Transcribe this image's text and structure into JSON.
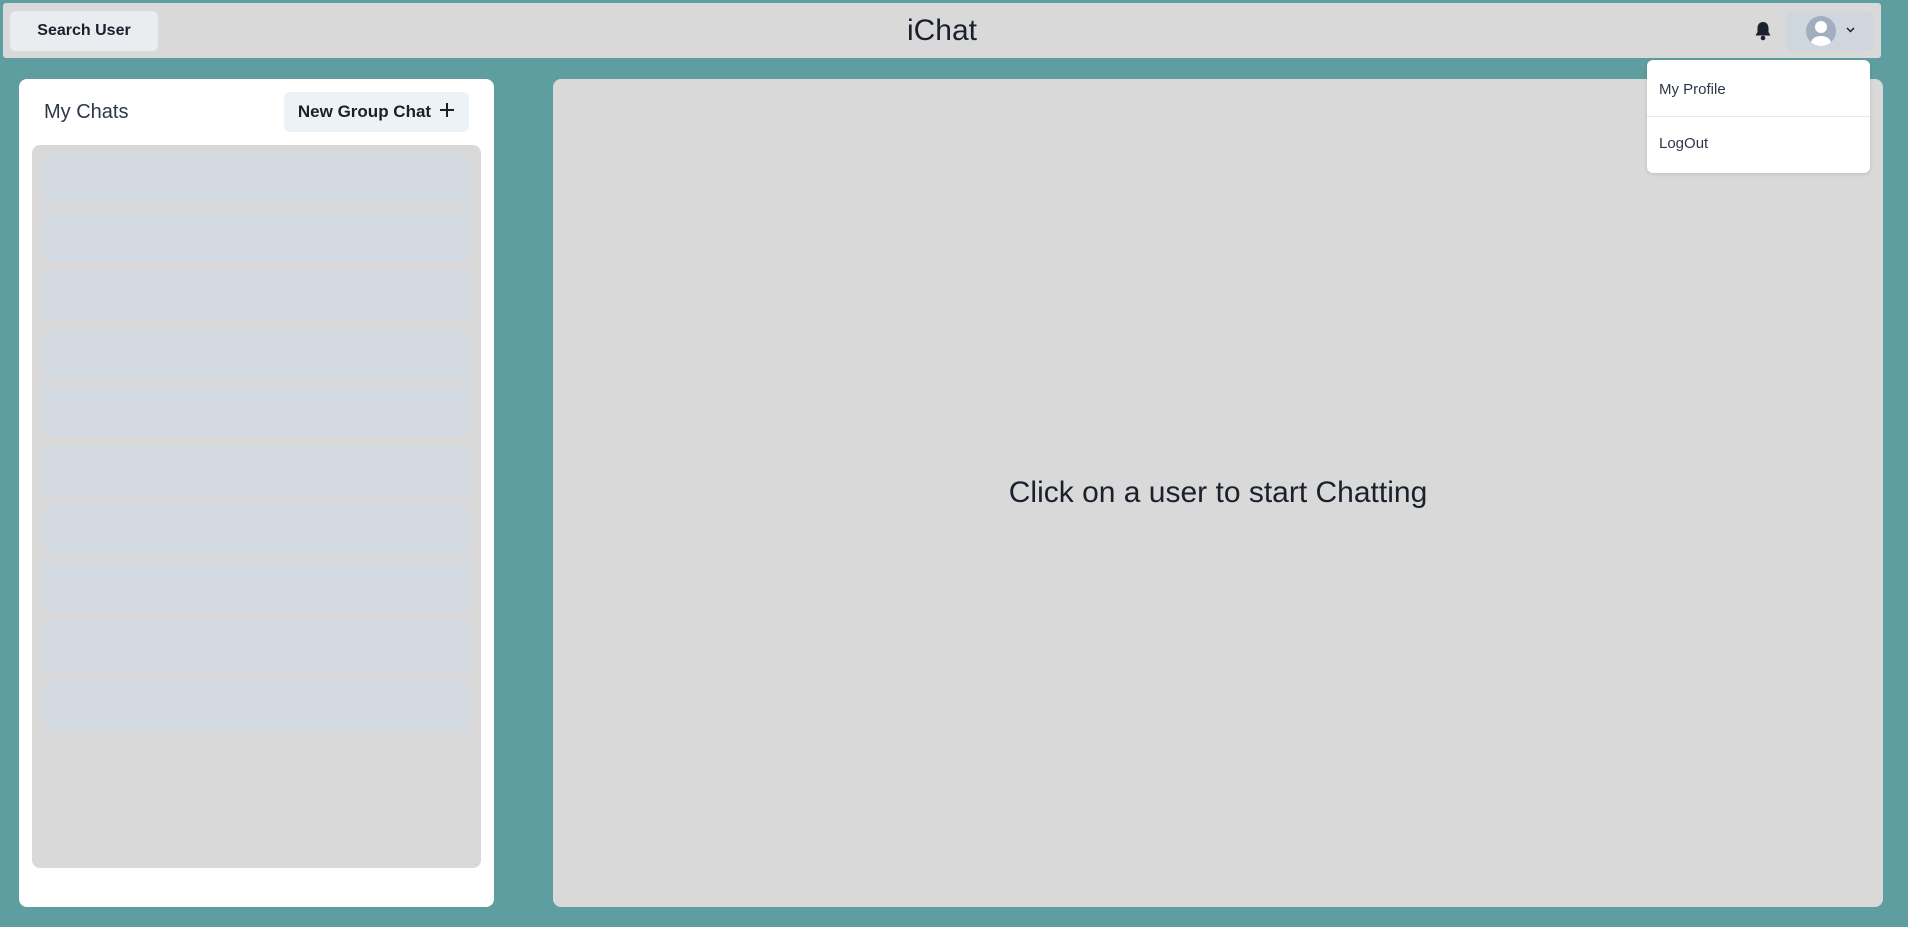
{
  "header": {
    "search_label": "Search User",
    "app_title": "iChat",
    "bell_icon": "bell-icon",
    "avatar_icon": "user-avatar-icon",
    "chevron_icon": "chevron-down-icon"
  },
  "profile_menu": {
    "items": [
      {
        "label": "My Profile"
      },
      {
        "label": "LogOut"
      }
    ]
  },
  "sidebar": {
    "title": "My Chats",
    "new_group_label": "New Group Chat",
    "new_group_icon": "plus-icon",
    "skeleton_count": 10
  },
  "main": {
    "placeholder": "Click on a user to start Chatting"
  },
  "colors": {
    "background": "#5f9ea0",
    "header_bg": "#d9d9d9",
    "panel_bg": "#ffffff",
    "skeleton": "#d2d9e1"
  }
}
